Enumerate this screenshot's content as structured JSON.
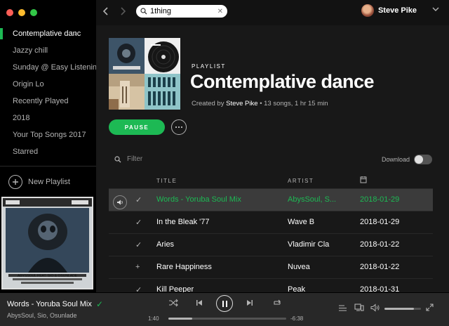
{
  "sidebar": {
    "items": [
      {
        "label": "Contemplative danc",
        "count": "↓↓",
        "active": true
      },
      {
        "label": "Jazzy chill"
      },
      {
        "label": "Sunday @ Easy Listenin"
      },
      {
        "label": "Origin Lo"
      },
      {
        "label": "Recently Played"
      },
      {
        "label": "2018"
      },
      {
        "label": "Your Top Songs 2017"
      },
      {
        "label": "Starred"
      }
    ],
    "new_playlist": "New Playlist",
    "now_art_caption": "ABYSSOUL FEAT. SIO & OSUNLADE"
  },
  "topbar": {
    "search_value": "1thing",
    "user_name": "Steve Pike"
  },
  "playlist": {
    "eyebrow": "PLAYLIST",
    "title": "Contemplative dance",
    "meta_prefix": "Created by",
    "owner": "Steve Pike",
    "meta_suffix": "• 13 songs, 1 hr 15 min",
    "pause_label": "PAUSE",
    "filter_placeholder": "Filter",
    "download_label": "Download",
    "columns": {
      "title": "TITLE",
      "artist": "ARTIST"
    },
    "tracks": [
      {
        "title": "Words - Yoruba Soul Mix",
        "artist": "AbysSoul, S...",
        "date": "2018-01-29",
        "playing": true
      },
      {
        "title": "In the Bleak '77",
        "artist": "Wave B",
        "date": "2018-01-29"
      },
      {
        "title": "Aries",
        "artist": "Vladimir Cla",
        "date": "2018-01-22"
      },
      {
        "title": "Rare Happiness",
        "artist": "Nuvea",
        "date": "2018-01-22"
      },
      {
        "title": "Kill Peeper",
        "artist": "Peak",
        "date": "2018-01-31"
      }
    ]
  },
  "player": {
    "title": "Words - Yoruba Soul Mix",
    "artist": "AbysSoul, Sio, Osunlade",
    "elapsed": "1:40",
    "remaining": "-6:38",
    "progress": 0.2,
    "volume": 0.8
  },
  "colors": {
    "accent": "#1db954",
    "background": "#181818",
    "sidebar": "#000000"
  },
  "icons": [
    "chevron-left-icon",
    "chevron-right-icon",
    "search-icon",
    "shuffle-icon",
    "previous-icon",
    "pause-icon",
    "next-icon",
    "repeat-icon",
    "queue-icon",
    "devices-icon",
    "volume-icon",
    "fullscreen-icon",
    "calendar-icon",
    "speaker-icon"
  ]
}
